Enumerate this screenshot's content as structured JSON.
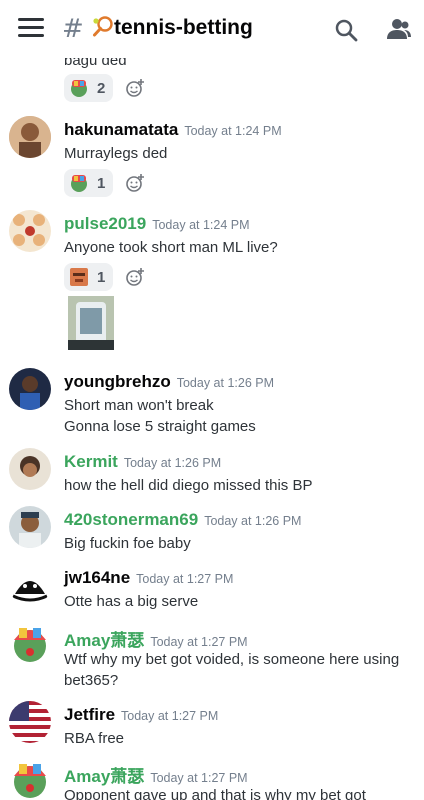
{
  "header": {
    "channel_name": "tennis-betting",
    "hash_symbol": "#"
  },
  "cutoff_text": "bagu ded",
  "messages": [
    {
      "username": "hakunamatata",
      "timestamp": "Today at 1:24 PM",
      "lines": [
        "Murraylegs ded"
      ],
      "reaction_count": "1"
    },
    {
      "username": "pulse2019",
      "timestamp": "Today at 1:24 PM",
      "lines": [
        "Anyone took short man ML live?"
      ],
      "reaction_count": "1"
    },
    {
      "username": "youngbrehzo",
      "timestamp": "Today at 1:26 PM",
      "lines": [
        "Short man won't break",
        "Gonna lose 5 straight games"
      ]
    },
    {
      "username": "Kermit",
      "timestamp": "Today at 1:26 PM",
      "lines": [
        "how the hell did diego missed this BP"
      ]
    },
    {
      "username": "420stonerman69",
      "timestamp": "Today at 1:26 PM",
      "lines": [
        "Big fuckin foe baby"
      ]
    },
    {
      "username": "jw164ne",
      "timestamp": "Today at 1:27 PM",
      "lines": [
        "Otte has a big serve"
      ]
    },
    {
      "username": "Amay萧瑟",
      "timestamp": "Today at 1:27 PM",
      "lines": [
        "Wtf why my bet got voided, is someone here using",
        "bet365?"
      ]
    },
    {
      "username": "Jetfire",
      "timestamp": "Today at 1:27 PM",
      "lines": [
        "RBA free"
      ]
    },
    {
      "username": "Amay萧瑟",
      "timestamp": "Today at 1:27 PM",
      "lines": [
        "Opponent gave up and that is why my bet got"
      ]
    }
  ],
  "top_reaction_count": "2",
  "colors": {
    "accent_green": "#3ba55d",
    "timestamp_gray": "#747f8d",
    "text": "#2e3338"
  },
  "icons": [
    "menu-icon",
    "hash-icon",
    "tennis-racket-icon",
    "search-icon",
    "members-icon",
    "add-reaction-icon"
  ]
}
